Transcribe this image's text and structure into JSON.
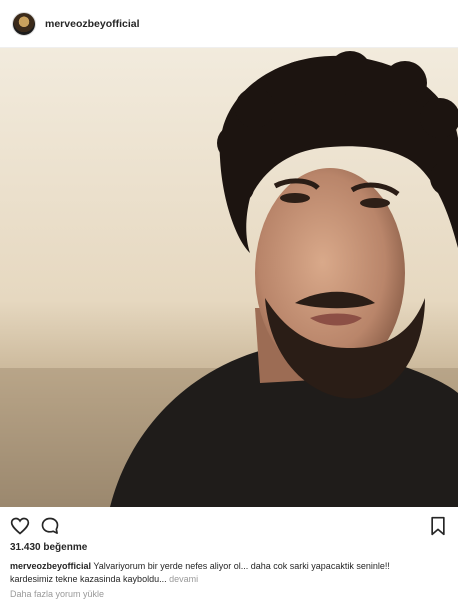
{
  "post": {
    "username": "merveozbeyofficial",
    "likes": "31.430 beğenme",
    "caption_user": "merveozbeyofficial",
    "caption_line1": "Yalvariyorum bir yerde nefes aliyor ol... daha cok sarki yapacaktik seninle!!",
    "caption_line2": "kardesimiz tekne kazasinda kayboldu...",
    "more_label": "devami",
    "load_more": "Daha fazla yorum yükle"
  },
  "icons": {
    "avatar": "profile-avatar",
    "like": "heart-icon",
    "comment": "comment-icon",
    "save": "bookmark-icon"
  },
  "colors": {
    "text": "#262626",
    "muted": "#999999",
    "border": "#efefef"
  }
}
